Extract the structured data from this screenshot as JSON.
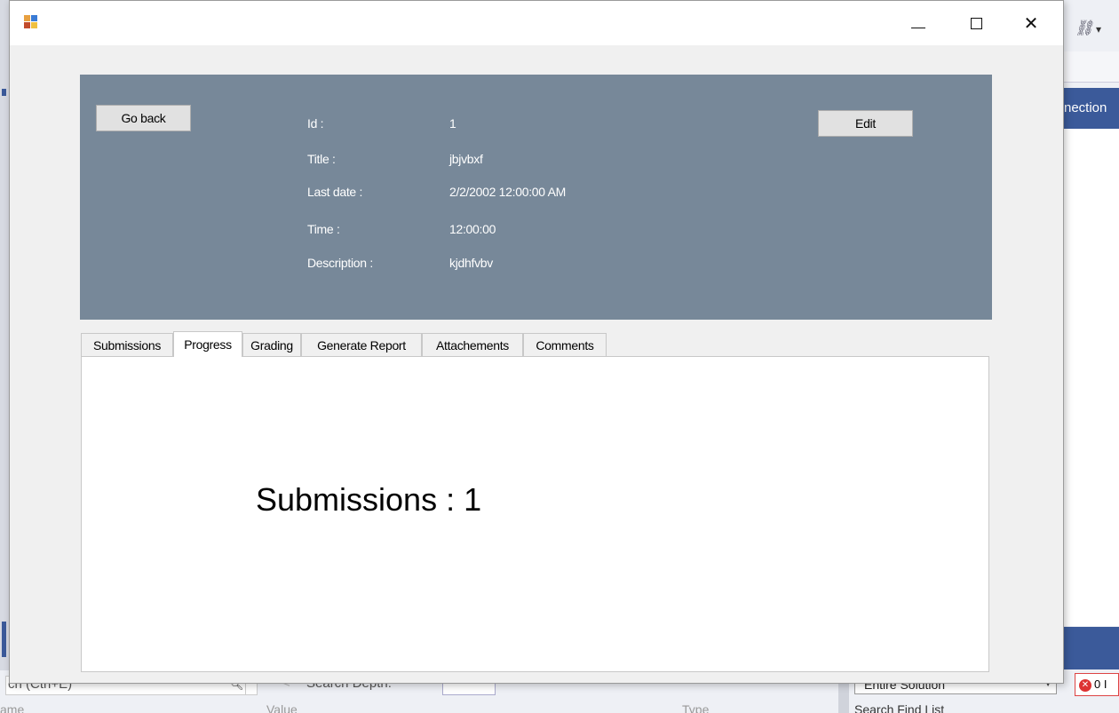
{
  "window": {
    "title": "",
    "controls": {
      "minimize": "—",
      "maximize": "☐",
      "close": "✕"
    }
  },
  "header": {
    "bg_color": "#778899",
    "go_back_label": "Go back",
    "edit_label": "Edit",
    "fields": {
      "id": {
        "label": "Id :",
        "value": "1"
      },
      "title": {
        "label": "Title :",
        "value": "jbjvbxf"
      },
      "last_date": {
        "label": "Last date :",
        "value": "2/2/2002 12:00:00 AM"
      },
      "time": {
        "label": "Time :",
        "value": "12:00:00"
      },
      "description": {
        "label": "Description :",
        "value": "kjdhfvbv"
      }
    }
  },
  "tabs": [
    {
      "label": "Submissions",
      "active": false
    },
    {
      "label": "Progress",
      "active": true
    },
    {
      "label": "Grading",
      "active": false
    },
    {
      "label": "Generate Report",
      "active": false
    },
    {
      "label": "Attachements",
      "active": false
    },
    {
      "label": "Comments",
      "active": false
    }
  ],
  "progress_panel": {
    "text": "Submissions : 1"
  },
  "background_ide": {
    "tool_window_header": "nection",
    "search_placeholder": "ch (Ctrl+E)",
    "search_depth_label": "Search Depth:",
    "scope_value": "Entire Solution",
    "columns": {
      "name": "ame",
      "value": "Value",
      "type": "Type"
    },
    "find_list_label": "Search Find List",
    "error_count": "0 I"
  }
}
